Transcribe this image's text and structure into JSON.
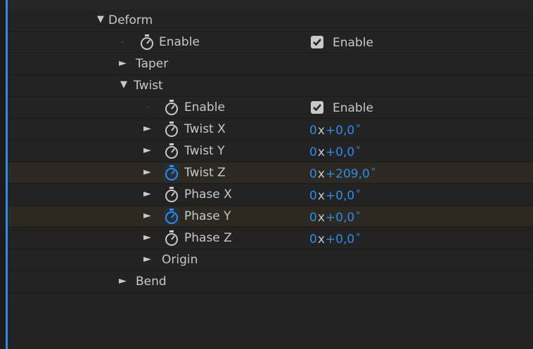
{
  "colors": {
    "background": "#232323",
    "row_divider": "#1a1a1a",
    "text": "#c8c8c8",
    "value_blue": "#2d8ceb",
    "highlight_row": "#2c2822",
    "selection_bar": "#2d8ceb"
  },
  "icons": {
    "expanded": "triangle-down-icon",
    "collapsed": "triangle-right-icon",
    "stopwatch": "stopwatch-icon",
    "checkbox": "checkmark-icon"
  },
  "symbols": {
    "expanded": "▼",
    "collapsed": "►",
    "degree": "°"
  },
  "deform": {
    "label": "Deform",
    "enable": {
      "label": "Enable",
      "checkbox_label": "Enable",
      "checked": true
    },
    "taper": {
      "label": "Taper"
    },
    "twist": {
      "label": "Twist",
      "enable": {
        "label": "Enable",
        "checkbox_label": "Enable",
        "checked": true
      },
      "twist_x": {
        "label": "Twist X",
        "revolutions": "0",
        "times": "x",
        "value": "+0,0",
        "keyframed": false
      },
      "twist_y": {
        "label": "Twist Y",
        "revolutions": "0",
        "times": "x",
        "value": "+0,0",
        "keyframed": false
      },
      "twist_z": {
        "label": "Twist Z",
        "revolutions": "0",
        "times": "x",
        "value": "+209,0",
        "keyframed": true
      },
      "phase_x": {
        "label": "Phase X",
        "revolutions": "0",
        "times": "x",
        "value": "+0,0",
        "keyframed": false
      },
      "phase_y": {
        "label": "Phase Y",
        "revolutions": "0",
        "times": "x",
        "value": "+0,0",
        "keyframed": true
      },
      "phase_z": {
        "label": "Phase Z",
        "revolutions": "0",
        "times": "x",
        "value": "+0,0",
        "keyframed": false
      },
      "origin": {
        "label": "Origin"
      }
    },
    "bend": {
      "label": "Bend"
    }
  }
}
